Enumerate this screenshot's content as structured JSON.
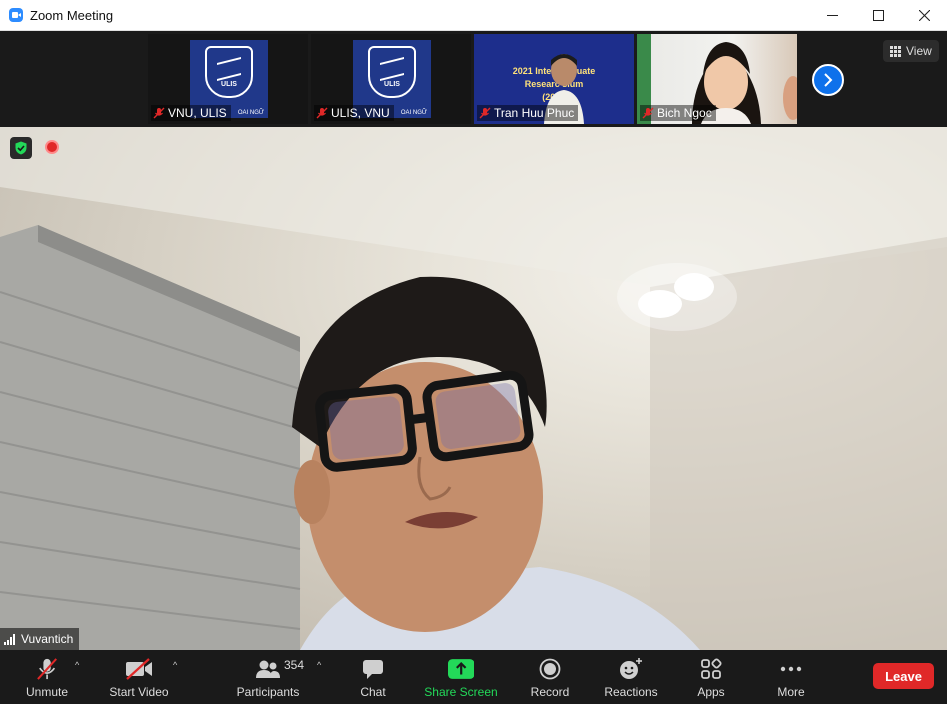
{
  "window": {
    "title": "Zoom Meeting",
    "controls": [
      "minimize",
      "maximize",
      "close"
    ]
  },
  "thumbnails": [
    {
      "name": "VNU, ULIS",
      "muted": true,
      "content": "ulis-logo",
      "logo_text": "ULIS",
      "caption": "OAI NGỮ"
    },
    {
      "name": "ULIS, VNU",
      "muted": true,
      "content": "ulis-logo",
      "logo_text": "ULIS",
      "caption": "OAI NGỮ"
    },
    {
      "name": "Tran Huu Phuc",
      "muted": true,
      "content": "slide",
      "slide_line1": "2021 Intern       raduate",
      "slide_line2": "Researc        sium",
      "slide_line3": "(202    )"
    },
    {
      "name": "Bich Ngoc",
      "muted": true,
      "content": "camera"
    }
  ],
  "strip": {
    "view_label": "View",
    "next_icon": "chevron-right-icon"
  },
  "main": {
    "speaker_name": "Vuvantich",
    "security_icon": "shield-check-icon",
    "recording_indicator": true
  },
  "toolbar": {
    "unmute": "Unmute",
    "start_video": "Start Video",
    "participants": "Participants",
    "participants_count": "354",
    "chat": "Chat",
    "share_screen": "Share Screen",
    "record": "Record",
    "reactions": "Reactions",
    "apps": "Apps",
    "more": "More",
    "leave": "Leave"
  },
  "colors": {
    "accent_blue": "#0e71eb",
    "share_green": "#23d959",
    "leave_red": "#e02828",
    "toolbar_bg": "#1a1a1a"
  }
}
